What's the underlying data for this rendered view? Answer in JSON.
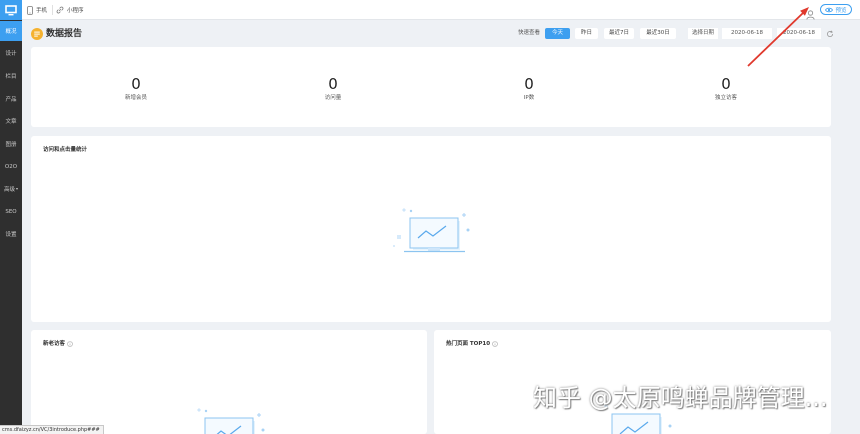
{
  "sidebar": {
    "logo_icon": "monitor-icon",
    "items": [
      {
        "label": "概况",
        "active": true
      },
      {
        "label": "设计"
      },
      {
        "label": "栏目"
      },
      {
        "label": "产品"
      },
      {
        "label": "文章"
      },
      {
        "label": "图册"
      },
      {
        "label": "O2O"
      },
      {
        "label": "高级",
        "icon": "chevron-down-icon"
      },
      {
        "label": "SEO"
      },
      {
        "label": "设置"
      }
    ]
  },
  "topbar": {
    "tabs": [
      {
        "label": "手机",
        "icon": "phone-icon"
      },
      {
        "label": "小程序",
        "icon": "link-icon"
      }
    ],
    "user_icon": "user-icon",
    "preview": {
      "label": "预览",
      "icon": "eye-icon"
    }
  },
  "report_header": {
    "icon": "report-icon",
    "title": "数据报告",
    "quick_view_label": "快速查看",
    "ranges": [
      {
        "label": "今天",
        "active": true
      },
      {
        "label": "昨日"
      },
      {
        "label": "最近7日"
      },
      {
        "label": "最近30日"
      }
    ],
    "date_label": "选择日期",
    "start_date": "2020-06-18",
    "end_date": "2020-06-18",
    "refresh_icon": "refresh-icon"
  },
  "stats": [
    {
      "value": "0",
      "label": "新增会员"
    },
    {
      "value": "0",
      "label": "访问量"
    },
    {
      "value": "0",
      "label": "IP数"
    },
    {
      "value": "0",
      "label": "独立访客"
    }
  ],
  "panels": {
    "traffic": {
      "title": "访问和点击量统计",
      "empty_icon": "empty-chart-icon"
    },
    "visitors": {
      "title": "新老访客",
      "info_icon": "info-icon"
    },
    "top_pages": {
      "title": "热门页面 TOP10",
      "info_icon": "info-icon"
    }
  },
  "status_bar": {
    "url": "cms.dfaizyz.cn/VC/3introduce.php###"
  },
  "watermark": "知乎 @太原鸣蝉品牌管理...",
  "colors": {
    "accent": "#3d9ff0",
    "sidebar_bg": "#2f2f2f",
    "title_icon": "#f5b230",
    "annotation": "#e0392d"
  }
}
